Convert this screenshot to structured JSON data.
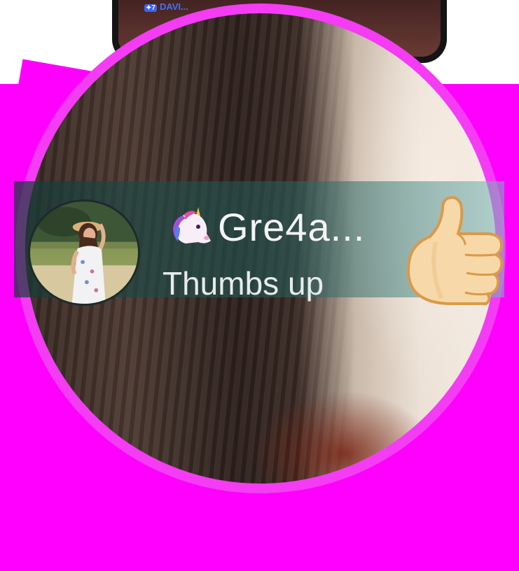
{
  "phone": {
    "badge": "✦7",
    "username": "DAVI..."
  },
  "notification": {
    "sender_emoji": "unicorn",
    "sender_name": "Gre4a...",
    "message": "Thumbs up",
    "reaction_icon": "thumbs-up",
    "avatar": "profile-photo"
  },
  "colors": {
    "background": "#ff00ff",
    "magnifier_border": "#f43cf4",
    "notification_band": "#2c5f5c",
    "text": "#f4f4f4"
  }
}
